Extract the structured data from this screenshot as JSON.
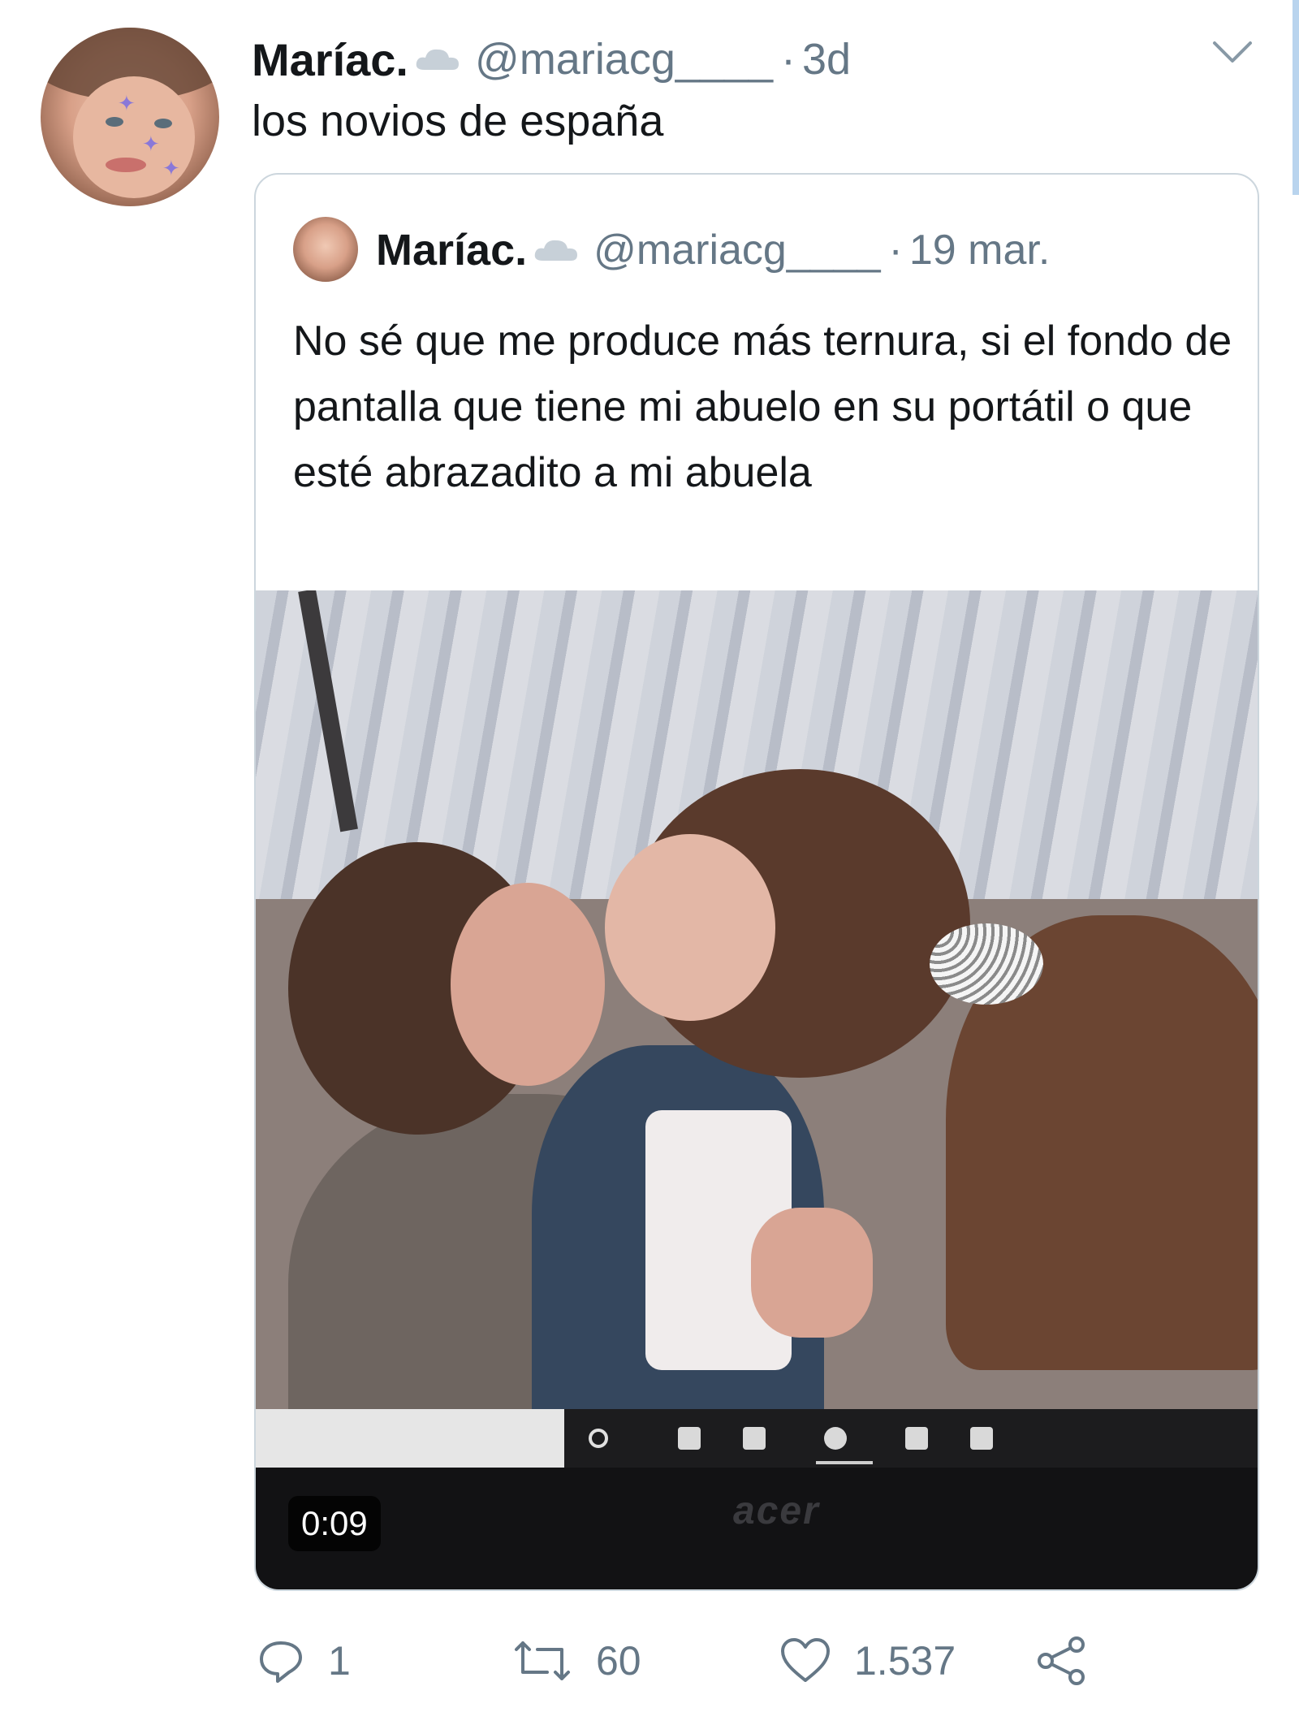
{
  "tweet": {
    "author": {
      "display_name": "Maríac.",
      "handle": "@mariacg____",
      "avatar_icon": "profile-photo"
    },
    "separator": "·",
    "time": "3d",
    "text": "los novios de españa",
    "menu_icon": "chevron-down-icon"
  },
  "quoted_tweet": {
    "author": {
      "display_name": "Maríac.",
      "handle": "@mariacg____",
      "avatar_icon": "profile-photo"
    },
    "separator": "·",
    "time": "19 mar.",
    "text": "No sé que me produce más ternura, si el fondo de pantalla que tiene mi abuelo en su portátil o que esté abrazadito a mi abuela",
    "media": {
      "type": "video",
      "duration": "0:09",
      "brand_text": "acer"
    }
  },
  "actions": {
    "reply": {
      "icon": "reply-icon",
      "count": "1"
    },
    "retweet": {
      "icon": "retweet-icon",
      "count": "60"
    },
    "like": {
      "icon": "heart-icon",
      "count": "1.537"
    },
    "share": {
      "icon": "share-icon"
    }
  },
  "colors": {
    "text_primary": "#14171a",
    "text_secondary": "#657786",
    "border": "#ccd6dd",
    "scroll_accent": "#b9d4ee"
  }
}
